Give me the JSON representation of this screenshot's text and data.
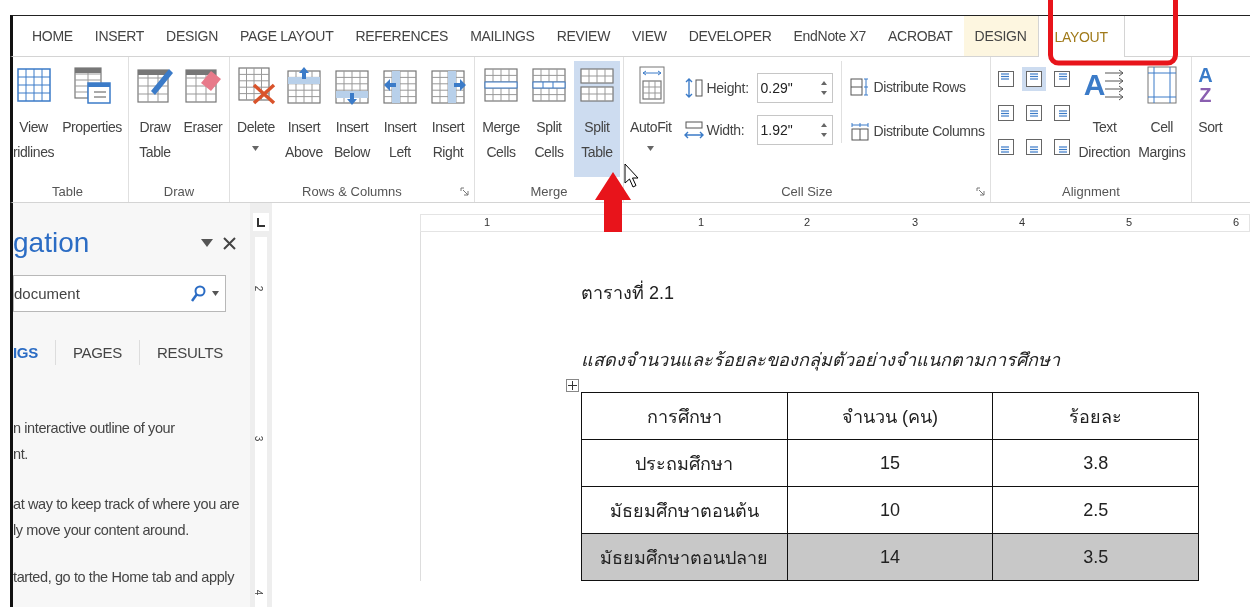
{
  "tabs": [
    {
      "label": "HOME",
      "selected": false,
      "contextual": false
    },
    {
      "label": "INSERT",
      "selected": false,
      "contextual": false
    },
    {
      "label": "DESIGN",
      "selected": false,
      "contextual": false
    },
    {
      "label": "PAGE LAYOUT",
      "selected": false,
      "contextual": false
    },
    {
      "label": "REFERENCES",
      "selected": false,
      "contextual": false
    },
    {
      "label": "MAILINGS",
      "selected": false,
      "contextual": false
    },
    {
      "label": "REVIEW",
      "selected": false,
      "contextual": false
    },
    {
      "label": "VIEW",
      "selected": false,
      "contextual": false
    },
    {
      "label": "DEVELOPER",
      "selected": false,
      "contextual": false
    },
    {
      "label": "EndNote X7",
      "selected": false,
      "contextual": false
    },
    {
      "label": "ACROBAT",
      "selected": false,
      "contextual": false
    },
    {
      "label": "DESIGN",
      "selected": false,
      "contextual": true
    },
    {
      "label": "LAYOUT",
      "selected": true,
      "contextual": true
    }
  ],
  "ribbon": {
    "groups": [
      {
        "label": "Table",
        "launcher": false,
        "buttons": [
          {
            "lines": [
              "View",
              "ridlines"
            ],
            "highlighted": false,
            "dropdown": false
          },
          {
            "lines": [
              "Properties"
            ],
            "highlighted": false,
            "dropdown": false
          }
        ]
      },
      {
        "label": "Draw",
        "launcher": false,
        "buttons": [
          {
            "lines": [
              "Draw",
              "Table"
            ],
            "highlighted": false,
            "dropdown": false
          },
          {
            "lines": [
              "Eraser"
            ],
            "highlighted": false,
            "dropdown": false
          }
        ]
      },
      {
        "label": "Rows & Columns",
        "launcher": true,
        "buttons": [
          {
            "lines": [
              "Delete"
            ],
            "highlighted": false,
            "dropdown": true
          },
          {
            "lines": [
              "Insert",
              "Above"
            ],
            "highlighted": false,
            "dropdown": false
          },
          {
            "lines": [
              "Insert",
              "Below"
            ],
            "highlighted": false,
            "dropdown": false
          },
          {
            "lines": [
              "Insert",
              "Left"
            ],
            "highlighted": false,
            "dropdown": false
          },
          {
            "lines": [
              "Insert",
              "Right"
            ],
            "highlighted": false,
            "dropdown": false
          }
        ]
      },
      {
        "label": "Merge",
        "launcher": false,
        "buttons": [
          {
            "lines": [
              "Merge",
              "Cells"
            ],
            "highlighted": false,
            "dropdown": false
          },
          {
            "lines": [
              "Split",
              "Cells"
            ],
            "highlighted": false,
            "dropdown": false
          },
          {
            "lines": [
              "Split",
              "Table"
            ],
            "highlighted": true,
            "dropdown": false
          }
        ]
      }
    ],
    "cell_size": {
      "label": "Cell Size",
      "autofit": {
        "lines": [
          "AutoFit"
        ],
        "dropdown": true
      },
      "fields": [
        {
          "label": "Height:",
          "value": "0.29\""
        },
        {
          "label": "Width:",
          "value": "1.92\""
        }
      ],
      "distribute": [
        "Distribute Rows",
        "Distribute Columns"
      ]
    },
    "alignment": {
      "label": "Alignment",
      "cells": [
        {
          "selected": false
        },
        {
          "selected": true
        },
        {
          "selected": false
        },
        {
          "selected": false
        },
        {
          "selected": false
        },
        {
          "selected": false
        },
        {
          "selected": false
        },
        {
          "selected": false
        },
        {
          "selected": false
        }
      ],
      "text_direction": {
        "glyph": "A",
        "lines": [
          "Text",
          "Direction"
        ]
      },
      "cell_margins": {
        "lines": [
          "Cell",
          "Margins"
        ]
      }
    },
    "sort": {
      "glyphs": [
        "A",
        "Z"
      ],
      "label": "Sort"
    }
  },
  "navigation": {
    "title": "gation",
    "search": {
      "placeholder": "document"
    },
    "tabs": [
      {
        "label": "IGS",
        "selected": true
      },
      {
        "label": "PAGES",
        "selected": false
      },
      {
        "label": "RESULTS",
        "selected": false
      }
    ],
    "paragraphs": [
      [
        "n interactive outline of your",
        "nt."
      ],
      [
        "at way to keep track of where you are",
        "ly move your content around."
      ],
      [
        "tarted, go to the Home tab and apply"
      ]
    ]
  },
  "ruler": {
    "horizontal": [
      "1",
      "1",
      "2",
      "3",
      "4",
      "5",
      "6"
    ],
    "vertical": [
      "2",
      "3",
      "4"
    ]
  },
  "document": {
    "heading": "ตารางที่ 2.1",
    "caption": "แสดงจำนวนและร้อยละของกลุ่มตัวอย่างจำแนกตามการศึกษา",
    "table": {
      "columns": [
        "การศึกษา",
        "จำนวน (คน)",
        "ร้อยละ"
      ],
      "rows": [
        {
          "cells": [
            "ประถมศึกษา",
            "15",
            "3.8"
          ],
          "selected": false
        },
        {
          "cells": [
            "มัธยมศึกษาตอนต้น",
            "10",
            "2.5"
          ],
          "selected": false
        },
        {
          "cells": [
            "มัธยมศึกษาตอนปลาย",
            "14",
            "3.5"
          ],
          "selected": true
        }
      ]
    }
  }
}
